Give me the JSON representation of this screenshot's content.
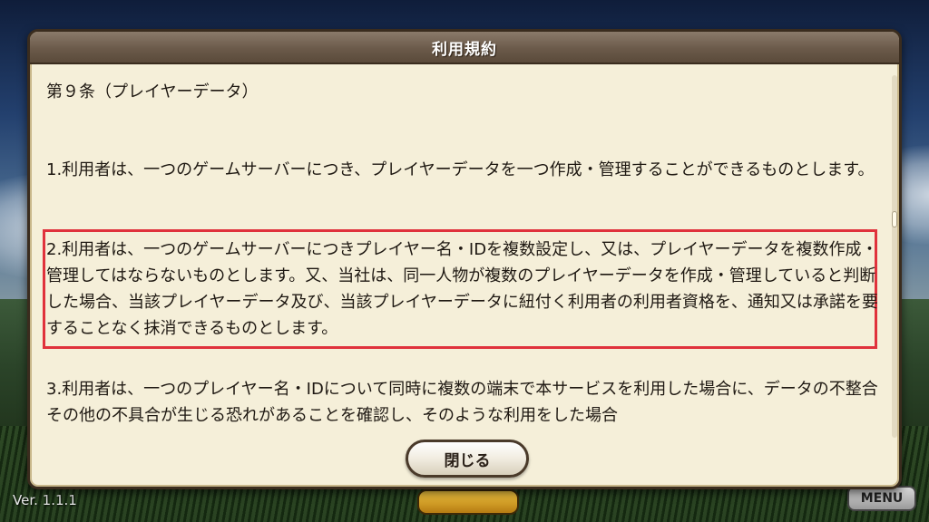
{
  "dialog": {
    "title": "利用規約",
    "heading": "第９条（プレイヤーデータ）",
    "paragraphs": [
      "1.利用者は、一つのゲームサーバーにつき、プレイヤーデータを一つ作成・管理することができるものとします。",
      "2.利用者は、一つのゲームサーバーにつきプレイヤー名・IDを複数設定し、又は、プレイヤーデータを複数作成・管理してはならないものとします。又、当社は、同一人物が複数のプレイヤーデータを作成・管理していると判断した場合、当該プレイヤーデータ及び、当該プレイヤーデータに紐付く利用者の利用者資格を、通知又は承諾を要することなく抹消できるものとします。",
      "3.利用者は、一つのプレイヤー名・IDについて同時に複数の端末で本サービスを利用した場合に、データの不整合その他の不具合が生じる恐れがあることを確認し、そのような利用をした場合"
    ],
    "close_label": "閉じる",
    "highlight_color": "#e0323c"
  },
  "footer": {
    "version": "Ver. 1.1.1",
    "menu_label": "MENU"
  }
}
